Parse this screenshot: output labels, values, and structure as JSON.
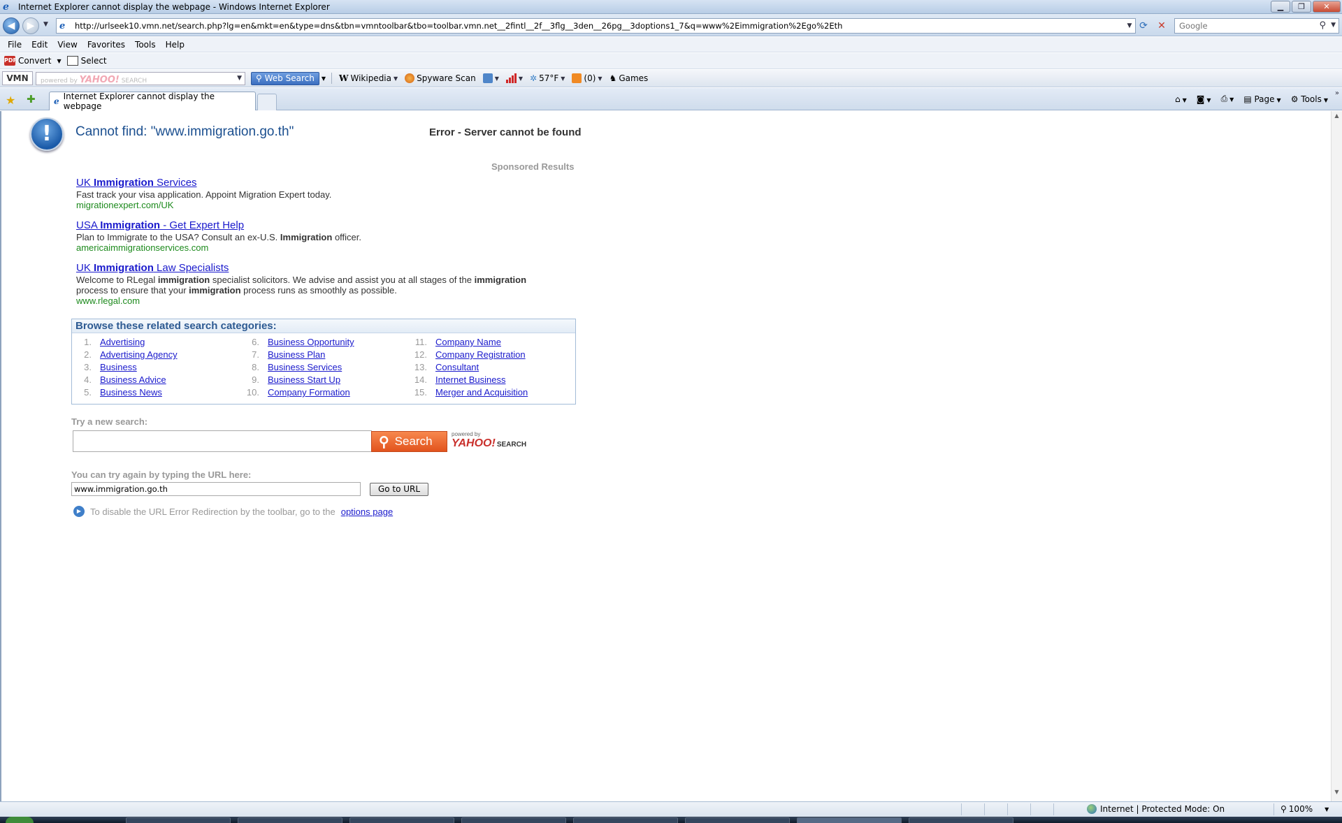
{
  "window": {
    "title": "Internet Explorer cannot display the webpage - Windows Internet Explorer"
  },
  "address": {
    "url": "http://urlseek10.vmn.net/search.php?lg=en&mkt=en&type=dns&tbn=vmntoolbar&tbo=toolbar.vmn.net__2fintl__2f__3flg__3den__26pg__3doptions1_7&q=www%2Eimmigration%2Ego%2Eth",
    "search_placeholder": "Google"
  },
  "menu": [
    "File",
    "Edit",
    "View",
    "Favorites",
    "Tools",
    "Help"
  ],
  "convert_bar": {
    "convert_label": "Convert",
    "select_label": "Select"
  },
  "vmn_bar": {
    "logo": "VMN",
    "powered_by": "powered by",
    "yahoo": "YAHOO!",
    "search_word": "SEARCH",
    "web_search_label": "Web Search",
    "wikipedia_label": "Wikipedia",
    "spyware_label": "Spyware Scan",
    "weather_label": "57°F",
    "rss_label": "(0)",
    "games_label": "Games"
  },
  "tabs": {
    "active_title": "Internet Explorer cannot display the webpage",
    "commands": [
      "Page",
      "Tools"
    ]
  },
  "page": {
    "cannot_find": "Cannot find: \"www.immigration.go.th\"",
    "server_error": "Error - Server cannot be found",
    "sponsored_label": "Sponsored Results",
    "ads": [
      {
        "title_pre": "UK ",
        "title_bold": "Immigration",
        "title_post": " Services",
        "desc_html_parts": [
          "Fast track your visa application. Appoint Migration Expert today."
        ],
        "url": "migrationexpert.com/UK"
      },
      {
        "title_pre": "USA ",
        "title_bold": "Immigration",
        "title_post": " - Get Expert Help",
        "desc_pre": "Plan to Immigrate to the USA? Consult an ex-U.S. ",
        "desc_bold": "Immigration",
        "desc_post": " officer.",
        "url": "americaimmigrationservices.com"
      },
      {
        "title_pre": "UK ",
        "title_bold": "Immigration",
        "title_post": " Law Specialists",
        "desc_line1_pre": "Welcome to RLegal ",
        "desc_line1_b1": "immigration",
        "desc_line1_mid": " specialist solicitors. We advise and assist you at all stages of the ",
        "desc_line1_b2": "immigration",
        "desc_line2_pre": "process to ensure that your ",
        "desc_line2_b": "immigration",
        "desc_line2_post": " process runs as smoothly as possible.",
        "url": "www.rlegal.com"
      }
    ],
    "browse_heading": "Browse these related search categories:",
    "categories": [
      [
        "1.",
        "Advertising"
      ],
      [
        "2.",
        "Advertising Agency"
      ],
      [
        "3.",
        "Business"
      ],
      [
        "4.",
        "Business Advice"
      ],
      [
        "5.",
        "Business News"
      ],
      [
        "6.",
        "Business Opportunity"
      ],
      [
        "7.",
        "Business Plan"
      ],
      [
        "8.",
        "Business Services"
      ],
      [
        "9.",
        "Business Start Up"
      ],
      [
        "10.",
        "Company Formation"
      ],
      [
        "11.",
        "Company Name"
      ],
      [
        "12.",
        "Company Registration"
      ],
      [
        "13.",
        "Consultant"
      ],
      [
        "14.",
        "Internet Business"
      ],
      [
        "15.",
        "Merger and Acquisition"
      ]
    ],
    "try_new_search": "Try a new search:",
    "search_button": "Search",
    "powered_by": "powered by",
    "yahoo": "YAHOO!",
    "yahoo_search": "SEARCH",
    "try_url_label": "You can try again by typing the URL here:",
    "url_value": "www.immigration.go.th",
    "go_button": "Go to URL",
    "disable_text": "To disable the URL Error Redirection by the toolbar, go to the",
    "options_link": "options page"
  },
  "status": {
    "zone": "Internet | Protected Mode: On",
    "zoom": "100%"
  }
}
